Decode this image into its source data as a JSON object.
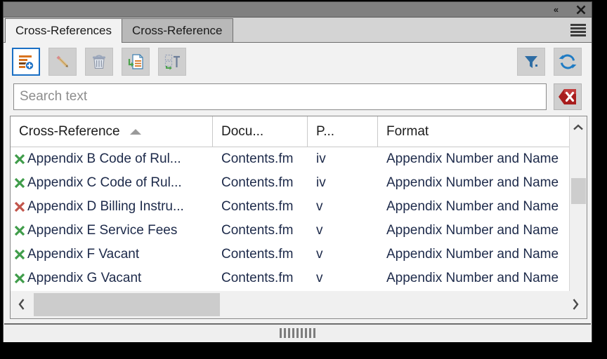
{
  "window": {
    "titlebar": {
      "collapse_label": "«",
      "close_label": "✕"
    }
  },
  "tabs": [
    {
      "label": "Cross-References",
      "active": true
    },
    {
      "label": "Cross-Reference",
      "active": false
    }
  ],
  "panel_menu": {
    "name": "panel-menu",
    "icon": "hamburger-icon"
  },
  "toolbar": {
    "buttons": [
      {
        "name": "insert-cross-reference-button",
        "icon": "insert-list-plus-icon",
        "selected": true,
        "enabled": true
      },
      {
        "name": "edit-cross-reference-button",
        "icon": "pencil-icon",
        "selected": false,
        "enabled": false
      },
      {
        "name": "delete-cross-reference-button",
        "icon": "trash-icon",
        "selected": false,
        "enabled": false
      },
      {
        "name": "convert-to-document-button",
        "icon": "document-arrow-icon",
        "selected": false,
        "enabled": false
      },
      {
        "name": "convert-to-text-button",
        "icon": "text-convert-icon",
        "selected": false,
        "enabled": false
      }
    ],
    "right_buttons": [
      {
        "name": "filter-button",
        "icon": "funnel-icon"
      },
      {
        "name": "refresh-button",
        "icon": "refresh-icon"
      }
    ]
  },
  "search": {
    "value": "",
    "placeholder": "Search text",
    "clear_button": {
      "name": "clear-search-button",
      "icon": "red-x-clear-icon"
    }
  },
  "table": {
    "columns": [
      {
        "key": "name",
        "label": "Cross-Reference",
        "sorted": "asc"
      },
      {
        "key": "doc",
        "label": "Docu...",
        "sorted": ""
      },
      {
        "key": "page",
        "label": "P...",
        "sorted": ""
      },
      {
        "key": "format",
        "label": "Format",
        "sorted": ""
      }
    ],
    "rows": [
      {
        "status": "valid",
        "name": "Appendix B Code of Rul...",
        "doc": "Contents.fm",
        "page": "iv",
        "format": "Appendix Number and Name"
      },
      {
        "status": "valid",
        "name": "Appendix C Code of Rul...",
        "doc": "Contents.fm",
        "page": "iv",
        "format": "Appendix Number and Name"
      },
      {
        "status": "broken",
        "name": "Appendix D Billing Instru...",
        "doc": "Contents.fm",
        "page": "v",
        "format": "Appendix Number and Name"
      },
      {
        "status": "valid",
        "name": "Appendix E Service Fees",
        "doc": "Contents.fm",
        "page": "v",
        "format": "Appendix Number and Name"
      },
      {
        "status": "valid",
        "name": "Appendix F Vacant",
        "doc": "Contents.fm",
        "page": "v",
        "format": "Appendix Number and Name"
      },
      {
        "status": "valid",
        "name": "Appendix G Vacant",
        "doc": "Contents.fm",
        "page": "v",
        "format": "Appendix Number and Name"
      }
    ]
  },
  "scrollbars": {
    "vertical": {
      "up_label": "⌃",
      "down_label": "⌄"
    },
    "horizontal": {
      "left_label": "‹",
      "right_label": "›"
    }
  },
  "colors": {
    "accent_blue": "#1a6fc4",
    "status_valid": "#3f9c4a",
    "status_broken": "#c2554b",
    "clear_red": "#a81d1d",
    "title_gray": "#808080",
    "panel_gray": "#f2f2f2"
  }
}
